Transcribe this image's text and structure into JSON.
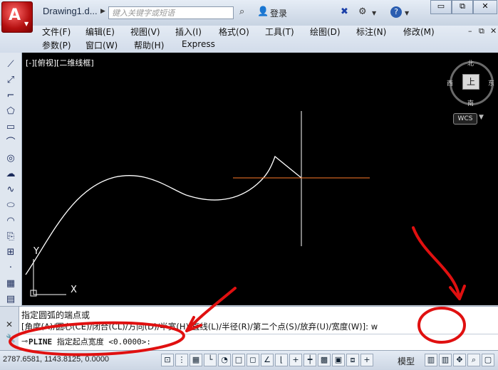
{
  "titlebar": {
    "doc_title": "Drawing1.d...",
    "search_placeholder": "键入关键字或短语",
    "login_label": "登录",
    "help_icon": "?"
  },
  "menu": {
    "row1": [
      "文件(F)",
      "编辑(E)",
      "视图(V)",
      "插入(I)",
      "格式(O)",
      "工具(T)",
      "绘图(D)",
      "标注(N)",
      "修改(M)"
    ],
    "row2": [
      "参数(P)",
      "窗口(W)",
      "帮助(H)",
      "Express"
    ]
  },
  "canvas": {
    "view_label": "[-][俯视][二维线框]",
    "viewcube": {
      "face": "上",
      "north": "北",
      "south": "南",
      "east": "东",
      "west": "西"
    },
    "wcs_label": "WCS",
    "ucs_x": "X",
    "ucs_y": "Y",
    "colors": {
      "background": "#000000",
      "polyline": "#ffffff",
      "crosshair_v": "#ffffff",
      "crosshair_h": "#ff7a2a"
    }
  },
  "command": {
    "line1": "指定圆弧的端点或",
    "line2": "[角度(A)/圆心(CE)/闭合(CL)/方向(D)/半宽(H)/直线(L)/半径(R)/第二个点(S)/放弃(U)/宽度(W)]: w",
    "prompt_cmd": "PLINE",
    "prompt_text": "指定起点宽度 <0.0000>:"
  },
  "status": {
    "coords": "2787.6581, 1143.8125, 0.0000",
    "model_label": "模型"
  },
  "annotation_color": "#e01010"
}
